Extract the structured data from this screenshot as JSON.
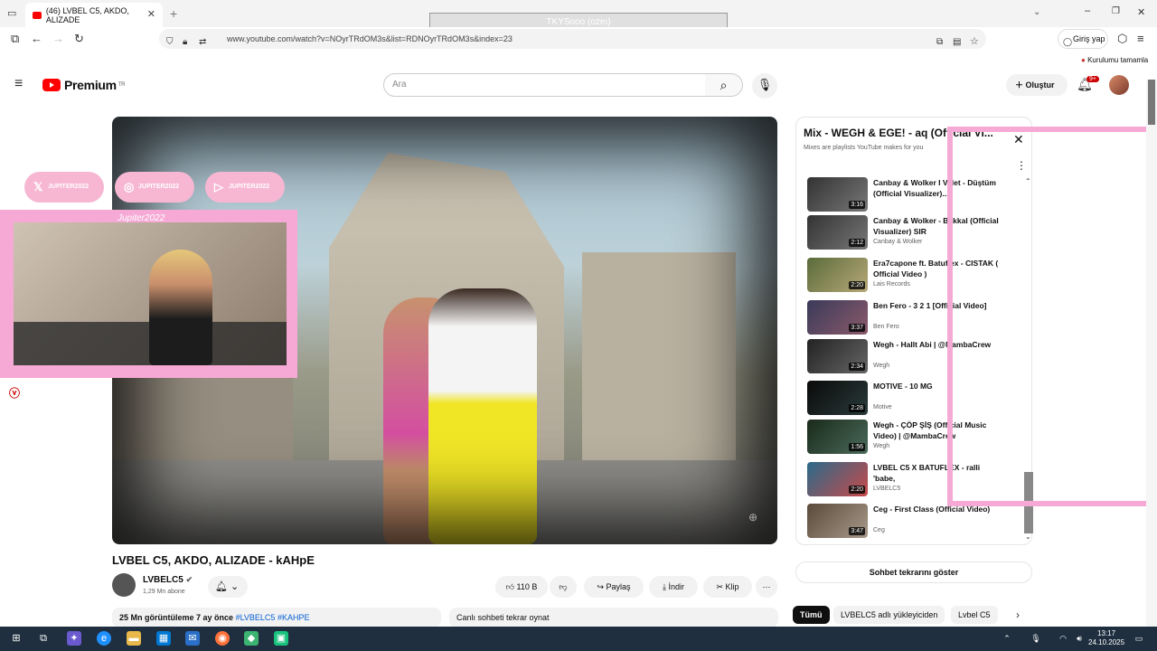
{
  "browser": {
    "tab_title": "(46) LVBEL C5, AKDO, ALIZADE",
    "url": "www.youtube.com/watch?v=NOyrTRdOM3s&list=RDNOyrTRdOM3s&index=23",
    "signin_label": "Giriş yap",
    "notice_label": "Kurulumu tamamla",
    "overlay_text": "TKYSooo (ozeı)"
  },
  "yt": {
    "logo_text": "Premium",
    "logo_region": "TR",
    "search_placeholder": "Ara",
    "create_label": "Oluştur",
    "notif_badge": "9+"
  },
  "stream_overlay": {
    "socials": [
      "JUPITER2022",
      "JUPITER2022",
      "JUPITER2022"
    ],
    "cam_title": "Jupiter2022"
  },
  "video": {
    "title": "LVBEL C5, AKDO, ALIZADE - kAHpE",
    "channel": "LVBELC5",
    "subs": "1,29 Mn abone",
    "likes": "110 B",
    "share_label": "Paylaş",
    "download_label": "İndir",
    "clip_label": "Klip",
    "views": "25 Mn görüntüleme",
    "age": "7 ay önce",
    "tags": "#LVBELC5 #KAHPE",
    "replay_label": "Canlı sohbeti tekrar oynat"
  },
  "playlist": {
    "title": "Mix - WEGH & EGE! - aq (Official Vi...",
    "subtitle": "Mixes are playlists YouTube makes for you",
    "items": [
      {
        "title": "Canbay & Wolker I Velet - Düştüm (Official Visualizer)...",
        "channel": "",
        "duration": "3:16"
      },
      {
        "title": "Canbay & Wolker - Bakkal (Official Visualizer) SIR",
        "channel": "Canbay & Wolker",
        "duration": "2:12"
      },
      {
        "title": "Era7capone ft. Batuflex - CISTAK ( Official Video )",
        "channel": "Lais Records",
        "duration": "2:20"
      },
      {
        "title": "Ben Fero - 3 2 1 [Official Video]",
        "channel": "Ben Fero",
        "duration": "3:37"
      },
      {
        "title": "Wegh - Hallt Abi | @MambaCrew",
        "channel": "Wegh",
        "duration": "2:34"
      },
      {
        "title": "MOTIVE - 10 MG",
        "channel": "Motive",
        "duration": "2:28"
      },
      {
        "title": "Wegh - ÇÖP ŞİŞ (Official Music Video) | @MambaCrew",
        "channel": "Wegh",
        "duration": "1:56"
      },
      {
        "title": "LVBEL C5 X BATUFLEX - ralli 'babe,",
        "channel": "LVBELC5",
        "duration": "2:20"
      },
      {
        "title": "Ceg - First Class (Official Video)",
        "channel": "Ceg",
        "duration": "3:47"
      }
    ],
    "chat_button": "Sohbet tekrarını göster",
    "chips": [
      "Tümü",
      "LVBELC5 adlı yükleyiciden",
      "Lvbel C5"
    ]
  },
  "taskbar": {
    "time": "13:17",
    "date": "24.10.2025"
  },
  "colors": {
    "yt_red": "#ff0000",
    "overlay_pink": "#f6a9d5",
    "taskbar_bg": "#1f2f3f"
  }
}
